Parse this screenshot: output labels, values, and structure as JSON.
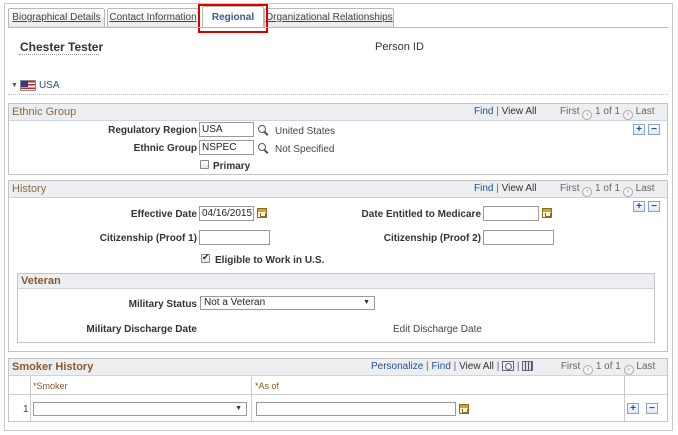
{
  "tabs": [
    {
      "label": "Biographical Details",
      "active": false
    },
    {
      "label": "Contact Information",
      "active": false
    },
    {
      "label": "Regional",
      "active": true
    },
    {
      "label": "Organizational Relationships",
      "active": false
    }
  ],
  "person": {
    "name": "Chester Tester",
    "id_label": "Person ID"
  },
  "country": {
    "label": "USA"
  },
  "ethnic_group": {
    "title": "Ethnic Group",
    "find": "Find",
    "sep": "|",
    "view_all": "View All",
    "first": "First",
    "counter": "1 of 1",
    "last": "Last",
    "regulatory_region_label": "Regulatory Region",
    "regulatory_region_value": "USA",
    "regulatory_region_desc": "United States",
    "ethnic_group_label": "Ethnic Group",
    "ethnic_group_value": "NSPEC",
    "ethnic_group_desc": "Not Specified",
    "primary_label": "Primary"
  },
  "history": {
    "title": "History",
    "find": "Find",
    "sep": "|",
    "view_all": "View All",
    "first": "First",
    "counter": "1 of 1",
    "last": "Last",
    "effective_date_label": "Effective Date",
    "effective_date_value": "04/16/2015",
    "medicare_label": "Date Entitled to Medicare",
    "medicare_value": "",
    "citizenship1_label": "Citizenship (Proof 1)",
    "citizenship1_value": "",
    "citizenship2_label": "Citizenship (Proof 2)",
    "citizenship2_value": "",
    "eligible_label": "Eligible to Work in U.S."
  },
  "veteran": {
    "title": "Veteran",
    "military_status_label": "Military Status",
    "military_status_value": "Not a Veteran",
    "discharge_label": "Military Discharge Date",
    "edit_discharge": "Edit Discharge Date"
  },
  "smoker": {
    "title": "Smoker History",
    "personalize": "Personalize",
    "find": "Find",
    "sep": "|",
    "view_all": "View All",
    "first": "First",
    "counter": "1 of 1",
    "last": "Last",
    "col_smoker": "*Smoker",
    "col_asof": "*As of",
    "row_num": "1",
    "smoker_value": "",
    "asof_value": ""
  },
  "icons": {
    "plus": "+",
    "minus": "−",
    "prev": "‹",
    "next": "›",
    "dropdown": "▼"
  }
}
